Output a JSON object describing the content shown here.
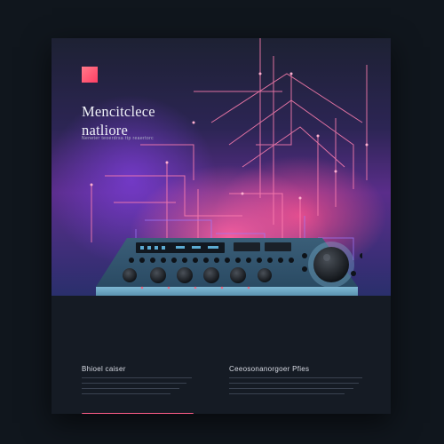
{
  "poster": {
    "title_line1": "Mencitclece",
    "title_line2": "natliore",
    "subtitle": "Neneter teoerdrsa ttp reaertorc",
    "left_section": {
      "heading": "Bhioel caiser"
    },
    "right_section": {
      "heading": "Ceeosonanorgoer Pfies"
    }
  },
  "colors": {
    "accent_pink": "#ff5e88",
    "accent_square": "#ff5a72",
    "background": "#10161d",
    "panel": "#151b24"
  }
}
